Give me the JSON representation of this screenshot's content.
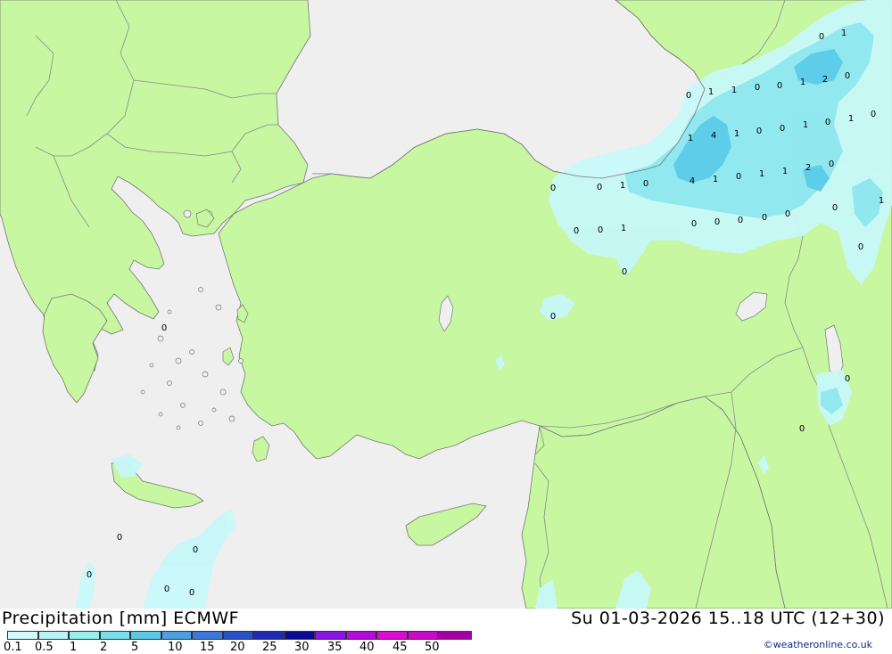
{
  "title": "Precipitation [mm] ECMWF",
  "datetime": "Su 01-03-2026 15..18 UTC (12+30)",
  "credit": "©weatheronline.co.uk",
  "colors": {
    "sea": "#efefef",
    "land": "#c7f7a0",
    "border": "#8a8a8a",
    "coast": "#777777"
  },
  "scale": {
    "labels": [
      "0.1",
      "0.5",
      "1",
      "2",
      "5",
      "10",
      "15",
      "20",
      "25",
      "30",
      "35",
      "40",
      "45",
      "50"
    ],
    "colors": [
      "#d2fafa",
      "#b4f5f5",
      "#96eeee",
      "#78e0ec",
      "#5ac8e6",
      "#4aa0e0",
      "#3c78dc",
      "#2850c8",
      "#1e2ab4",
      "#0a0a96",
      "#8c14e6",
      "#b40adc",
      "#dc0ad2",
      "#c80ac8",
      "#a000a0"
    ]
  },
  "map_values": [
    {
      "t": "0"
    },
    {
      "t": "1"
    },
    {
      "t": "0"
    },
    {
      "t": "1"
    },
    {
      "t": "1"
    },
    {
      "t": "0"
    },
    {
      "t": "0"
    },
    {
      "t": "1"
    },
    {
      "t": "2"
    },
    {
      "t": "0"
    },
    {
      "t": "1"
    },
    {
      "t": "4"
    },
    {
      "t": "1"
    },
    {
      "t": "0"
    },
    {
      "t": "0"
    },
    {
      "t": "1"
    },
    {
      "t": "0"
    },
    {
      "t": "1"
    },
    {
      "t": "0"
    },
    {
      "t": "0"
    },
    {
      "t": "0"
    },
    {
      "t": "1"
    },
    {
      "t": "0"
    },
    {
      "t": "4"
    },
    {
      "t": "1"
    },
    {
      "t": "0"
    },
    {
      "t": "1"
    },
    {
      "t": "1"
    },
    {
      "t": "2"
    },
    {
      "t": "0"
    },
    {
      "t": "0"
    },
    {
      "t": "1"
    },
    {
      "t": "0"
    },
    {
      "t": "0"
    },
    {
      "t": "1"
    },
    {
      "t": "0"
    },
    {
      "t": "0"
    },
    {
      "t": "0"
    },
    {
      "t": "0"
    },
    {
      "t": "0"
    },
    {
      "t": "0"
    },
    {
      "t": "0"
    },
    {
      "t": "0"
    },
    {
      "t": "0"
    },
    {
      "t": "0"
    },
    {
      "t": "0"
    },
    {
      "t": "0"
    },
    {
      "t": "0"
    },
    {
      "t": "0"
    },
    {
      "t": "0"
    },
    {
      "t": "0"
    }
  ]
}
